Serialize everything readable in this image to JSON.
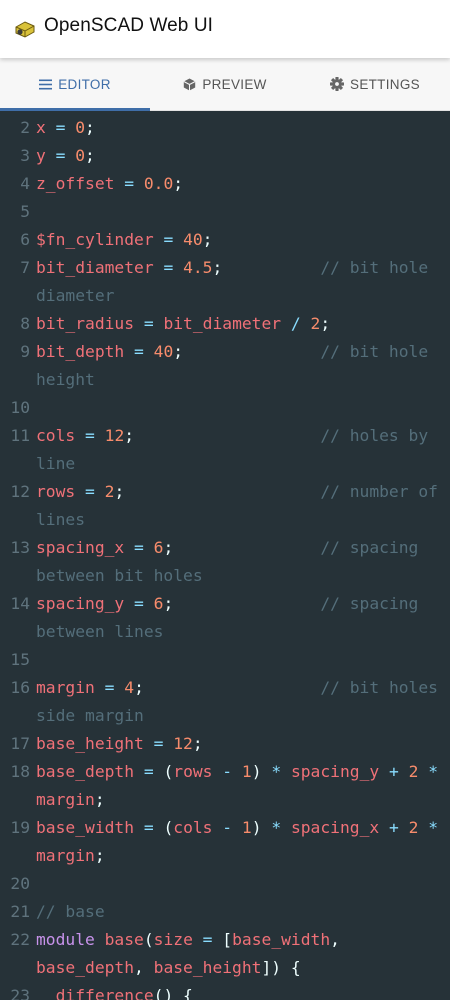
{
  "app": {
    "title": "OpenSCAD Web UI",
    "logo_icon": "openscad-logo-icon"
  },
  "tabs": [
    {
      "label": "EDITOR",
      "icon": "list-icon",
      "active": true
    },
    {
      "label": "PREVIEW",
      "icon": "cube-icon",
      "active": false
    },
    {
      "label": "SETTINGS",
      "icon": "gear-icon",
      "active": false
    }
  ],
  "colors": {
    "editor_bg": "#263238",
    "accent": "#3f6ea8",
    "identifier": "#f07178",
    "number": "#f78c6c",
    "operator": "#89ddff",
    "comment": "#546e7a",
    "keyword": "#c792ea",
    "gutter": "#5f737d"
  },
  "editor": {
    "lines": [
      {
        "n": "2",
        "tokens": [
          [
            "ident",
            "x"
          ],
          [
            "op",
            " = "
          ],
          [
            "num",
            "0"
          ],
          [
            "p",
            ";"
          ]
        ]
      },
      {
        "n": "3",
        "tokens": [
          [
            "ident",
            "y"
          ],
          [
            "op",
            " = "
          ],
          [
            "num",
            "0"
          ],
          [
            "p",
            ";"
          ]
        ]
      },
      {
        "n": "4",
        "tokens": [
          [
            "ident",
            "z_offset"
          ],
          [
            "op",
            " = "
          ],
          [
            "num",
            "0.0"
          ],
          [
            "p",
            ";"
          ]
        ]
      },
      {
        "n": "5",
        "tokens": []
      },
      {
        "n": "6",
        "tokens": [
          [
            "ident",
            "$fn_cylinder"
          ],
          [
            "op",
            " = "
          ],
          [
            "num",
            "40"
          ],
          [
            "p",
            ";"
          ]
        ]
      },
      {
        "n": "7",
        "tokens": [
          [
            "ident",
            "bit_diameter"
          ],
          [
            "op",
            " = "
          ],
          [
            "num",
            "4.5"
          ],
          [
            "p",
            ";"
          ],
          [
            "p",
            "          "
          ],
          [
            "cmt",
            "// bit hole diameter"
          ]
        ]
      },
      {
        "n": "8",
        "tokens": [
          [
            "ident",
            "bit_radius"
          ],
          [
            "op",
            " = "
          ],
          [
            "ident",
            "bit_diameter"
          ],
          [
            "op",
            " / "
          ],
          [
            "num",
            "2"
          ],
          [
            "p",
            ";"
          ]
        ]
      },
      {
        "n": "9",
        "tokens": [
          [
            "ident",
            "bit_depth"
          ],
          [
            "op",
            " = "
          ],
          [
            "num",
            "40"
          ],
          [
            "p",
            ";"
          ],
          [
            "p",
            "              "
          ],
          [
            "cmt",
            "// bit hole height"
          ]
        ]
      },
      {
        "n": "10",
        "tokens": []
      },
      {
        "n": "11",
        "tokens": [
          [
            "ident",
            "cols"
          ],
          [
            "op",
            " = "
          ],
          [
            "num",
            "12"
          ],
          [
            "p",
            ";"
          ],
          [
            "p",
            "                   "
          ],
          [
            "cmt",
            "// holes by line"
          ]
        ]
      },
      {
        "n": "12",
        "tokens": [
          [
            "ident",
            "rows"
          ],
          [
            "op",
            " = "
          ],
          [
            "num",
            "2"
          ],
          [
            "p",
            ";"
          ],
          [
            "p",
            "                    "
          ],
          [
            "cmt",
            "// number of lines"
          ]
        ]
      },
      {
        "n": "13",
        "tokens": [
          [
            "ident",
            "spacing_x"
          ],
          [
            "op",
            " = "
          ],
          [
            "num",
            "6"
          ],
          [
            "p",
            ";"
          ],
          [
            "p",
            "               "
          ],
          [
            "cmt",
            "// spacing between bit holes"
          ]
        ]
      },
      {
        "n": "14",
        "tokens": [
          [
            "ident",
            "spacing_y"
          ],
          [
            "op",
            " = "
          ],
          [
            "num",
            "6"
          ],
          [
            "p",
            ";"
          ],
          [
            "p",
            "               "
          ],
          [
            "cmt",
            "// spacing between lines"
          ]
        ]
      },
      {
        "n": "15",
        "tokens": []
      },
      {
        "n": "16",
        "tokens": [
          [
            "ident",
            "margin"
          ],
          [
            "op",
            " = "
          ],
          [
            "num",
            "4"
          ],
          [
            "p",
            ";"
          ],
          [
            "p",
            "                  "
          ],
          [
            "cmt",
            "// bit holes side margin"
          ]
        ]
      },
      {
        "n": "17",
        "tokens": [
          [
            "ident",
            "base_height"
          ],
          [
            "op",
            " = "
          ],
          [
            "num",
            "12"
          ],
          [
            "p",
            ";"
          ]
        ]
      },
      {
        "n": "18",
        "tokens": [
          [
            "ident",
            "base_depth"
          ],
          [
            "op",
            " = "
          ],
          [
            "p",
            "("
          ],
          [
            "ident",
            "rows"
          ],
          [
            "op",
            " - "
          ],
          [
            "num",
            "1"
          ],
          [
            "p",
            ")"
          ],
          [
            "op",
            " * "
          ],
          [
            "ident",
            "spacing_y"
          ],
          [
            "op",
            " + "
          ],
          [
            "num",
            "2"
          ],
          [
            "op",
            " * "
          ],
          [
            "ident",
            "margin"
          ],
          [
            "p",
            ";"
          ]
        ]
      },
      {
        "n": "19",
        "tokens": [
          [
            "ident",
            "base_width"
          ],
          [
            "op",
            " = "
          ],
          [
            "p",
            "("
          ],
          [
            "ident",
            "cols"
          ],
          [
            "op",
            " - "
          ],
          [
            "num",
            "1"
          ],
          [
            "p",
            ")"
          ],
          [
            "op",
            " * "
          ],
          [
            "ident",
            "spacing_x"
          ],
          [
            "op",
            " + "
          ],
          [
            "num",
            "2"
          ],
          [
            "op",
            " * "
          ],
          [
            "ident",
            "margin"
          ],
          [
            "p",
            ";"
          ]
        ]
      },
      {
        "n": "20",
        "tokens": []
      },
      {
        "n": "21",
        "tokens": [
          [
            "cmt",
            "// base"
          ]
        ]
      },
      {
        "n": "22",
        "tokens": [
          [
            "kw",
            "module "
          ],
          [
            "ident",
            "base"
          ],
          [
            "p",
            "("
          ],
          [
            "ident",
            "size"
          ],
          [
            "op",
            " = "
          ],
          [
            "p",
            "["
          ],
          [
            "ident",
            "base_width"
          ],
          [
            "p",
            ", "
          ],
          [
            "ident",
            "base_depth"
          ],
          [
            "p",
            ", "
          ],
          [
            "ident",
            "base_height"
          ],
          [
            "p",
            "]) {"
          ]
        ]
      },
      {
        "n": "23",
        "tokens": [
          [
            "p",
            "  "
          ],
          [
            "ident",
            "difference"
          ],
          [
            "p",
            "() {"
          ]
        ]
      }
    ]
  }
}
